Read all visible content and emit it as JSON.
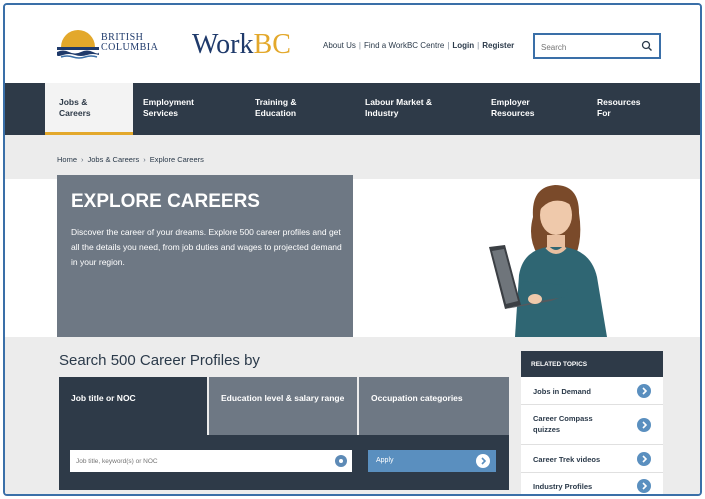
{
  "header": {
    "logo_bc_line1": "BRITISH",
    "logo_bc_line2": "COLUMBIA",
    "logo_work": "Work",
    "logo_bc": "BC",
    "links": {
      "about": "About Us",
      "find_centre": "Find a WorkBC Centre",
      "login": "Login",
      "register": "Register"
    },
    "search_placeholder": "Search"
  },
  "nav": {
    "items": [
      {
        "label_1": "Jobs &",
        "label_2": "Careers"
      },
      {
        "label_1": "Employment",
        "label_2": "Services"
      },
      {
        "label_1": "Training &",
        "label_2": "Education"
      },
      {
        "label_1": "Labour Market &",
        "label_2": "Industry"
      },
      {
        "label_1": "Employer",
        "label_2": "Resources"
      },
      {
        "label_1": "Resources",
        "label_2": "For"
      }
    ]
  },
  "breadcrumb": [
    "Home",
    "Jobs & Careers",
    "Explore Careers"
  ],
  "hero": {
    "title": "EXPLORE CAREERS",
    "description": "Discover the career of your dreams. Explore 500 career profiles and get all the details you need, from job duties and wages to projected demand in your region."
  },
  "search_section": {
    "title": "Search 500 Career Profiles by",
    "tabs": [
      "Job title or NOC",
      "Education level & salary range",
      "Occupation categories"
    ],
    "input_placeholder": "Job title, keyword(s) or NOC",
    "apply_label": "Apply"
  },
  "related_topics": {
    "heading": "RELATED TOPICS",
    "items": [
      "Jobs in Demand",
      "Career Compass quizzes",
      "Career Trek videos",
      "Industry Profiles"
    ]
  },
  "colors": {
    "nav_bg": "#2e3a48",
    "accent_gold": "#e3a82b",
    "brand_navy": "#1f3a6b",
    "link_blue": "#5a8fbf"
  }
}
